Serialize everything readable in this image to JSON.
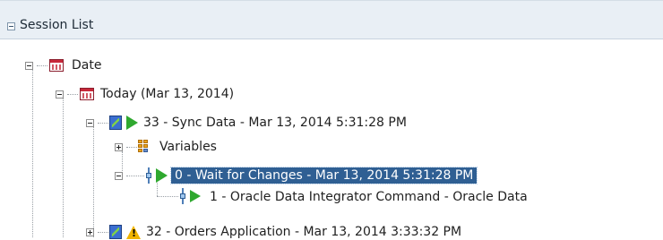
{
  "panel": {
    "title": "Session List"
  },
  "tree": {
    "date": {
      "label": "Date"
    },
    "today": {
      "label": "Today (Mar 13, 2014)"
    },
    "session33": {
      "label": "33 - Sync Data - Mar 13, 2014 5:31:28 PM"
    },
    "variables": {
      "label": "Variables"
    },
    "step0": {
      "label": "0 - Wait for Changes - Mar 13, 2014 5:31:28 PM"
    },
    "task1": {
      "label": "1 - Oracle Data Integrator Command - Oracle Data"
    },
    "session32": {
      "label": "32 - Orders Application - Mar 13, 2014 3:33:32 PM"
    }
  },
  "colors": {
    "header_bg": "#e9eff5",
    "selection_bg": "#2f5f93",
    "play_green": "#2fa82f",
    "warning_yellow": "#f0b400",
    "calendar_red": "#c8283a"
  }
}
